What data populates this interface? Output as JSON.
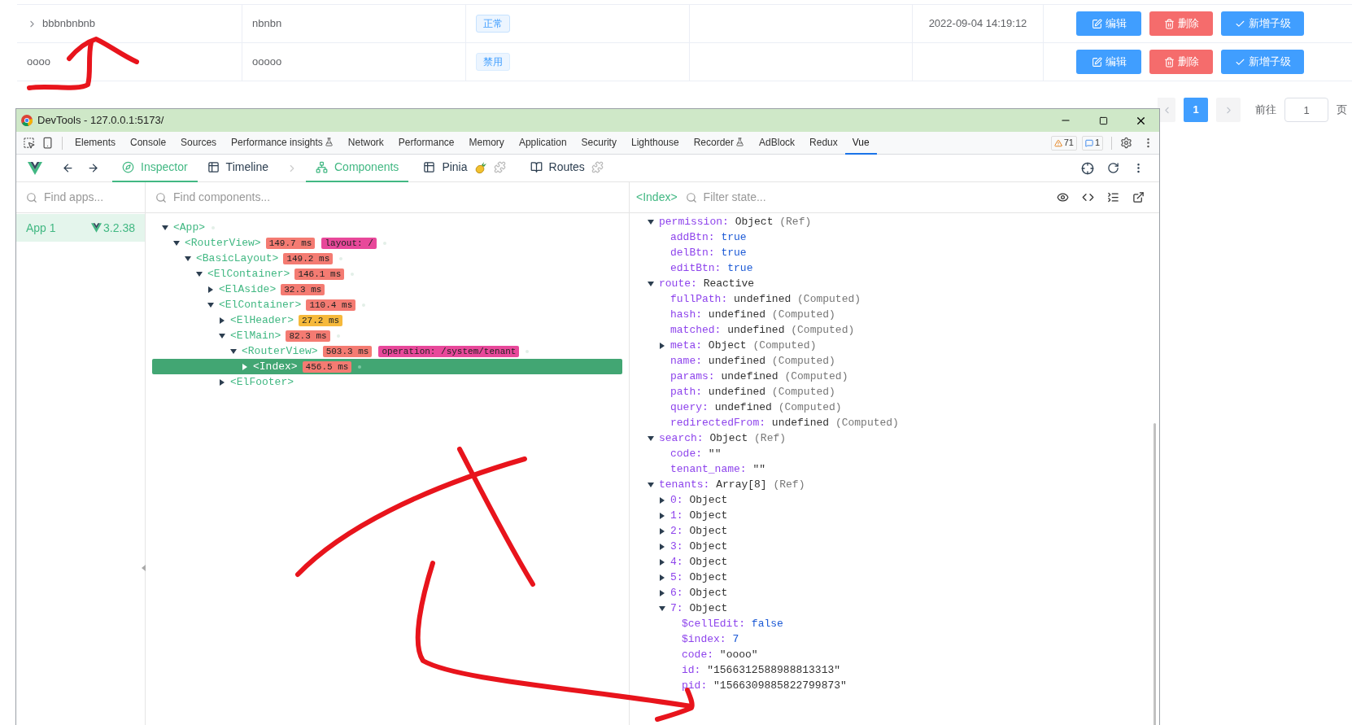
{
  "table": {
    "rows": [
      {
        "expandable": true,
        "name": "bbbnbnbnb",
        "code": "nbnbn",
        "status": {
          "label": "正常",
          "kind": "normal"
        },
        "column_4": "",
        "time": "2022-09-04 14:19:12",
        "actions": [
          {
            "label": "编辑",
            "kind": "edit"
          },
          {
            "label": "删除",
            "kind": "delete"
          },
          {
            "label": "新增子级",
            "kind": "add"
          }
        ]
      },
      {
        "expandable": false,
        "name": "oooo",
        "code": "ooooo",
        "status": {
          "label": "禁用",
          "kind": "disabled"
        },
        "column_4": "",
        "time": "",
        "actions": [
          {
            "label": "编辑",
            "kind": "edit"
          },
          {
            "label": "删除",
            "kind": "delete"
          },
          {
            "label": "新增子级",
            "kind": "add"
          }
        ]
      }
    ]
  },
  "pagination": {
    "pages": [
      {
        "label": "1",
        "selected": true
      }
    ],
    "goto_label": "前往",
    "goto_value": "1",
    "suffix": "页"
  },
  "devtools": {
    "title": "DevTools - 127.0.0.1:5173/",
    "tabs": [
      {
        "label": "Elements",
        "selected": false,
        "experimental": false
      },
      {
        "label": "Console",
        "selected": false,
        "experimental": false
      },
      {
        "label": "Sources",
        "selected": false,
        "experimental": false
      },
      {
        "label": "Performance insights",
        "selected": false,
        "experimental": true
      },
      {
        "label": "Network",
        "selected": false,
        "experimental": false
      },
      {
        "label": "Performance",
        "selected": false,
        "experimental": false
      },
      {
        "label": "Memory",
        "selected": false,
        "experimental": false
      },
      {
        "label": "Application",
        "selected": false,
        "experimental": false
      },
      {
        "label": "Security",
        "selected": false,
        "experimental": false
      },
      {
        "label": "Lighthouse",
        "selected": false,
        "experimental": false
      },
      {
        "label": "Recorder",
        "selected": false,
        "experimental": true
      },
      {
        "label": "AdBlock",
        "selected": false,
        "experimental": false
      },
      {
        "label": "Redux",
        "selected": false,
        "experimental": false
      },
      {
        "label": "Vue",
        "selected": true,
        "experimental": false
      }
    ],
    "warnings": "71",
    "messages": "1",
    "vue_tabs": [
      {
        "label": "Inspector",
        "kind": "inspector",
        "selected": true
      },
      {
        "label": "Timeline",
        "kind": "timeline",
        "selected": false
      }
    ],
    "inspector_tabs": [
      {
        "label": "Components",
        "kind": "components",
        "selected": true
      },
      {
        "label": "Pinia",
        "kind": "pinia",
        "selected": false
      },
      {
        "label": "Routes",
        "kind": "routes",
        "selected": false
      }
    ],
    "apps_placeholder": "Find apps...",
    "components_placeholder": "Find components...",
    "state_placeholder": "Filter state...",
    "inspected": "<Index>",
    "apps": [
      {
        "name": "App 1",
        "version": "3.2.38",
        "selected": true
      }
    ],
    "tree": [
      {
        "name": "<App>",
        "expanded": true,
        "dot": true,
        "selected": false,
        "children": [
          {
            "name": "<RouterView>",
            "expanded": true,
            "time": "149.7 ms",
            "color": "#f47b72",
            "tag": "layout: /",
            "dot": true,
            "selected": false,
            "children": [
              {
                "name": "<BasicLayout>",
                "expanded": true,
                "time": "149.2 ms",
                "color": "#f47b72",
                "dot": true,
                "selected": false,
                "children": [
                  {
                    "name": "<ElContainer>",
                    "expanded": true,
                    "time": "146.1 ms",
                    "color": "#f47b72",
                    "dot": true,
                    "selected": false,
                    "children": [
                      {
                        "name": "<ElAside>",
                        "expanded": false,
                        "time": "32.3 ms",
                        "color": "#f47b72",
                        "dot": false,
                        "selected": false
                      },
                      {
                        "name": "<ElContainer>",
                        "expanded": true,
                        "time": "110.4 ms",
                        "color": "#f47b72",
                        "dot": true,
                        "selected": false,
                        "children": [
                          {
                            "name": "<ElHeader>",
                            "expanded": false,
                            "time": "27.2 ms",
                            "color": "#f6b93b",
                            "dot": false,
                            "selected": false
                          },
                          {
                            "name": "<ElMain>",
                            "expanded": true,
                            "time": "82.3 ms",
                            "color": "#f47b72",
                            "dot": true,
                            "selected": false,
                            "children": [
                              {
                                "name": "<RouterView>",
                                "expanded": true,
                                "time": "503.3 ms",
                                "color": "#f47b72",
                                "tag": "operation: /system/tenant",
                                "dot": true,
                                "selected": false,
                                "children": [
                                  {
                                    "name": "<Index>",
                                    "expanded": false,
                                    "time": "456.5 ms",
                                    "color": "#f47b72",
                                    "dot": true,
                                    "selected": true
                                  }
                                ]
                              }
                            ]
                          },
                          {
                            "name": "<ElFooter>",
                            "expanded": false,
                            "dot": false,
                            "selected": false
                          }
                        ]
                      }
                    ]
                  }
                ]
              }
            ]
          }
        ]
      }
    ],
    "state": [
      {
        "key": "permission:",
        "value": "Object",
        "note": "(Ref)",
        "expanded": true,
        "children": [
          {
            "key": "addBtn:",
            "value": "true",
            "kind": "literal"
          },
          {
            "key": "delBtn:",
            "value": "true",
            "kind": "literal"
          },
          {
            "key": "editBtn:",
            "value": "true",
            "kind": "literal"
          }
        ]
      },
      {
        "key": "route:",
        "value": "Reactive",
        "expanded": true,
        "children": [
          {
            "key": "fullPath:",
            "value": "undefined",
            "note": "(Computed)"
          },
          {
            "key": "hash:",
            "value": "undefined",
            "note": "(Computed)"
          },
          {
            "key": "matched:",
            "value": "undefined",
            "note": "(Computed)"
          },
          {
            "key": "meta:",
            "value": "Object",
            "note": "(Computed)",
            "expanded": false
          },
          {
            "key": "name:",
            "value": "undefined",
            "note": "(Computed)"
          },
          {
            "key": "params:",
            "value": "undefined",
            "note": "(Computed)"
          },
          {
            "key": "path:",
            "value": "undefined",
            "note": "(Computed)"
          },
          {
            "key": "query:",
            "value": "undefined",
            "note": "(Computed)"
          },
          {
            "key": "redirectedFrom:",
            "value": "undefined",
            "note": "(Computed)"
          }
        ]
      },
      {
        "key": "search:",
        "value": "Object",
        "note": "(Ref)",
        "expanded": true,
        "children": [
          {
            "key": "code:",
            "value": "\"\""
          },
          {
            "key": "tenant_name:",
            "value": "\"\""
          }
        ]
      },
      {
        "key": "tenants:",
        "value": "Array[8]",
        "note": "(Ref)",
        "expanded": true,
        "children": [
          {
            "key": "0:",
            "value": "Object",
            "expanded": false
          },
          {
            "key": "1:",
            "value": "Object",
            "expanded": false
          },
          {
            "key": "2:",
            "value": "Object",
            "expanded": false
          },
          {
            "key": "3:",
            "value": "Object",
            "expanded": false
          },
          {
            "key": "4:",
            "value": "Object",
            "expanded": false
          },
          {
            "key": "5:",
            "value": "Object",
            "expanded": false
          },
          {
            "key": "6:",
            "value": "Object",
            "expanded": false
          },
          {
            "key": "7:",
            "value": "Object",
            "expanded": true,
            "children": [
              {
                "key": "$cellEdit:",
                "value": "false",
                "kind": "literal"
              },
              {
                "key": "$index:",
                "value": "7",
                "kind": "literal"
              },
              {
                "key": "code:",
                "value": "\"oooo\""
              },
              {
                "key": "id:",
                "value": "\"1566312588988813313\""
              },
              {
                "key": "pid:",
                "value": "\"1566309885822799873\""
              }
            ]
          }
        ]
      }
    ]
  }
}
